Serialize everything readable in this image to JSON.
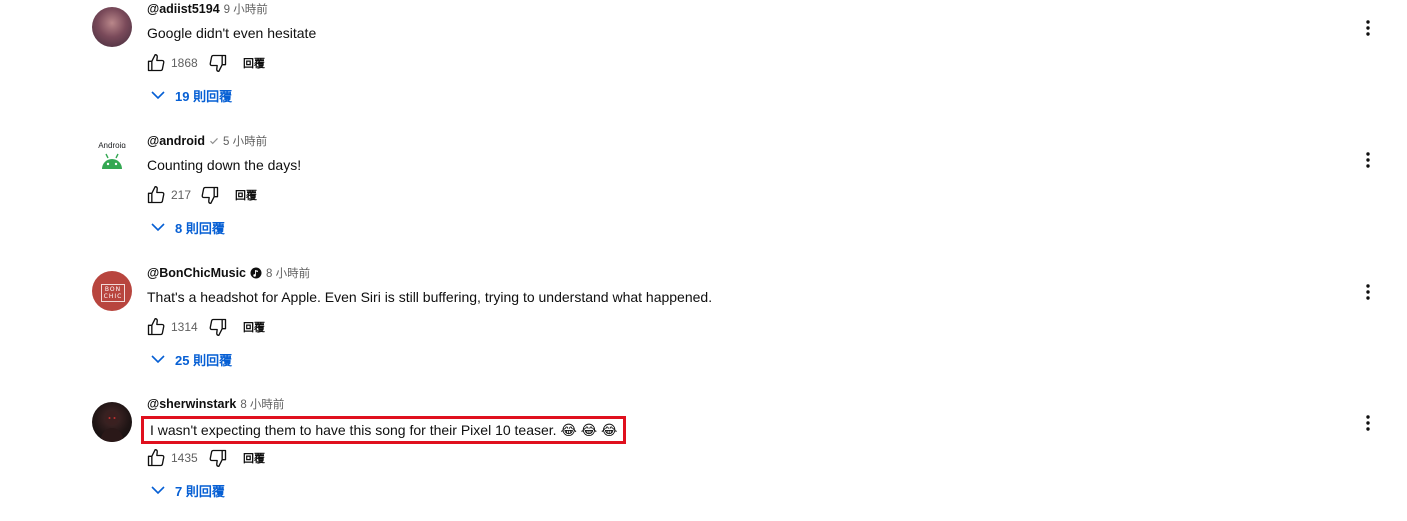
{
  "comments": [
    {
      "handle": "@adiist5194",
      "time": "9 小時前",
      "text": "Google didn't even hesitate",
      "likes": "1868",
      "reply_label": "回覆",
      "replies_label": "19 則回覆"
    },
    {
      "handle": "@android",
      "time": "5 小時前",
      "text": "Counting down the days!",
      "likes": "217",
      "reply_label": "回覆",
      "replies_label": "8 則回覆",
      "avatar_text": "Android"
    },
    {
      "handle": "@BonChicMusic",
      "time": "8 小時前",
      "text": "That's a headshot for Apple. Even Siri is still buffering, trying to understand what happened.",
      "likes": "1314",
      "reply_label": "回覆",
      "replies_label": "25 則回覆",
      "avatar_text": "BON CHIC"
    },
    {
      "handle": "@sherwinstark",
      "time": "8 小時前",
      "text": "I wasn't expecting them to have this song for their Pixel 10 teaser. 😂 😂 😂",
      "likes": "1435",
      "reply_label": "回覆",
      "replies_label": "7 則回覆"
    }
  ],
  "colors": {
    "link_blue": "#065fd4",
    "highlight_red": "#e0101e",
    "muted": "#606060"
  }
}
